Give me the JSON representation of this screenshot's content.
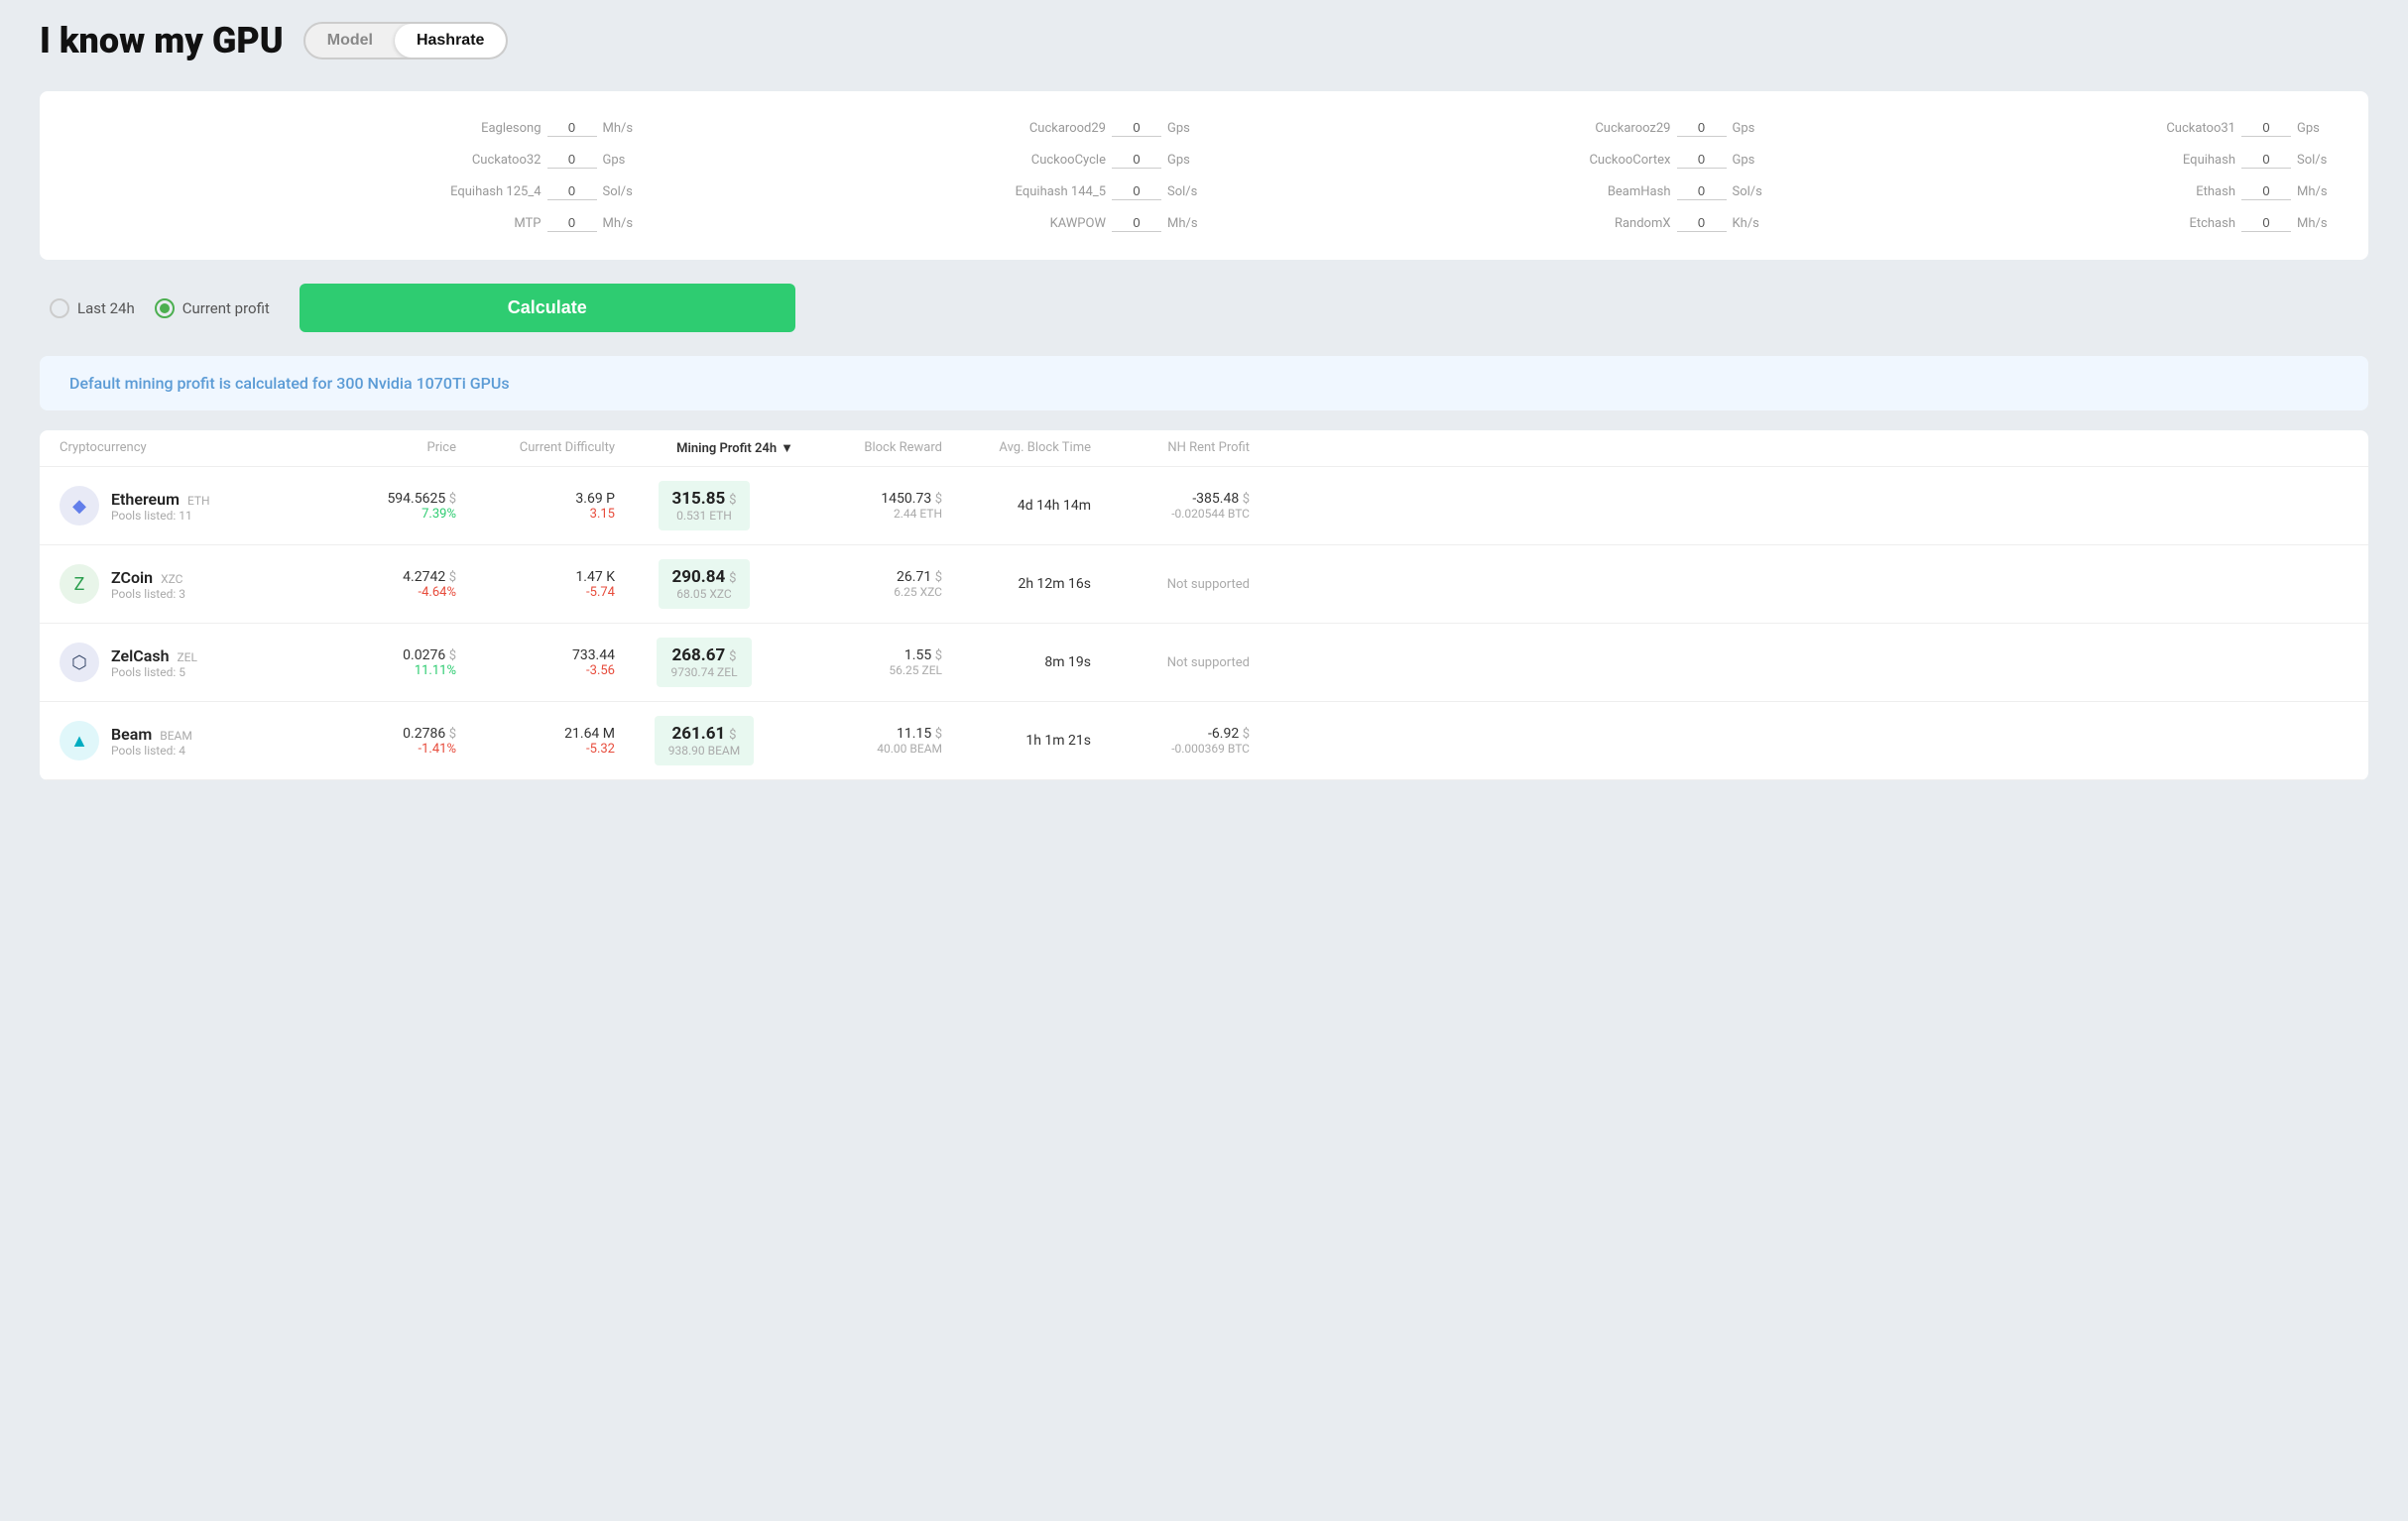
{
  "header": {
    "title": "I know my GPU",
    "toggle": {
      "model_label": "Model",
      "hashrate_label": "Hashrate",
      "active": "hashrate"
    }
  },
  "hashrate_fields": [
    {
      "label": "Eaglesong",
      "value": "0",
      "unit": "Mh/s"
    },
    {
      "label": "Cuckarood29",
      "value": "0",
      "unit": "Gps"
    },
    {
      "label": "Cuckarooz29",
      "value": "0",
      "unit": "Gps"
    },
    {
      "label": "Cuckatoo31",
      "value": "0",
      "unit": "Gps"
    },
    {
      "label": "Cuckatoo32",
      "value": "0",
      "unit": "Gps"
    },
    {
      "label": "CuckooCycle",
      "value": "0",
      "unit": "Gps"
    },
    {
      "label": "CuckooCortex",
      "value": "0",
      "unit": "Gps"
    },
    {
      "label": "Equihash",
      "value": "0",
      "unit": "Sol/s"
    },
    {
      "label": "Equihash 125_4",
      "value": "0",
      "unit": "Sol/s"
    },
    {
      "label": "Equihash 144_5",
      "value": "0",
      "unit": "Sol/s"
    },
    {
      "label": "BeamHash",
      "value": "0",
      "unit": "Sol/s"
    },
    {
      "label": "Ethash",
      "value": "0",
      "unit": "Mh/s"
    },
    {
      "label": "MTP",
      "value": "0",
      "unit": "Mh/s"
    },
    {
      "label": "KAWPOW",
      "value": "0",
      "unit": "Mh/s"
    },
    {
      "label": "RandomX",
      "value": "0",
      "unit": "Kh/s"
    },
    {
      "label": "Etchash",
      "value": "0",
      "unit": "Mh/s"
    }
  ],
  "controls": {
    "last24h_label": "Last 24h",
    "current_profit_label": "Current profit",
    "selected": "current_profit",
    "calculate_label": "Calculate"
  },
  "info_banner": {
    "text": "Default mining profit is calculated for 300 Nvidia 1070Ti GPUs"
  },
  "table": {
    "headers": [
      {
        "label": "Cryptocurrency",
        "sorted": false
      },
      {
        "label": "Price",
        "sorted": false
      },
      {
        "label": "Current Difficulty",
        "sorted": false
      },
      {
        "label": "Mining Profit 24h",
        "sorted": true
      },
      {
        "label": "Block Reward",
        "sorted": false
      },
      {
        "label": "Avg. Block Time",
        "sorted": false
      },
      {
        "label": "NH Rent Profit",
        "sorted": false
      }
    ],
    "rows": [
      {
        "coin": "Ethereum",
        "ticker": "ETH",
        "pools": "11",
        "icon_color": "#627eea",
        "icon_text": "◆",
        "price": "594.5625",
        "price_change": "7.39%",
        "price_change_positive": true,
        "difficulty": "3.69 P",
        "difficulty_change": "3.15",
        "difficulty_change_positive": false,
        "profit_main": "315.85",
        "profit_sub": "0.531 ETH",
        "block_reward": "1450.73",
        "block_reward_sub": "2.44 ETH",
        "avg_block_time": "4d 14h 14m",
        "nh_profit": "-385.48",
        "nh_profit_sub": "-0.020544 BTC",
        "nh_supported": true
      },
      {
        "coin": "ZCoin",
        "ticker": "XZC",
        "pools": "3",
        "icon_color": "#2d9f4f",
        "icon_text": "Z",
        "price": "4.2742",
        "price_change": "-4.64%",
        "price_change_positive": false,
        "difficulty": "1.47 K",
        "difficulty_change": "-5.74",
        "difficulty_change_positive": false,
        "profit_main": "290.84",
        "profit_sub": "68.05 XZC",
        "block_reward": "26.71",
        "block_reward_sub": "6.25 XZC",
        "avg_block_time": "2h 12m 16s",
        "nh_profit": "",
        "nh_profit_sub": "",
        "nh_supported": false
      },
      {
        "coin": "ZelCash",
        "ticker": "ZEL",
        "pools": "5",
        "icon_color": "#3a4a6b",
        "icon_text": "⬡",
        "price": "0.0276",
        "price_change": "11.11%",
        "price_change_positive": true,
        "difficulty": "733.44",
        "difficulty_change": "-3.56",
        "difficulty_change_positive": false,
        "profit_main": "268.67",
        "profit_sub": "9730.74 ZEL",
        "block_reward": "1.55",
        "block_reward_sub": "56.25 ZEL",
        "avg_block_time": "8m 19s",
        "nh_profit": "",
        "nh_profit_sub": "",
        "nh_supported": false
      },
      {
        "coin": "Beam",
        "ticker": "BEAM",
        "pools": "4",
        "icon_color": "#00d2ff",
        "icon_text": "▲",
        "price": "0.2786",
        "price_change": "-1.41%",
        "price_change_positive": false,
        "difficulty": "21.64 M",
        "difficulty_change": "-5.32",
        "difficulty_change_positive": false,
        "profit_main": "261.61",
        "profit_sub": "938.90 BEAM",
        "block_reward": "11.15",
        "block_reward_sub": "40.00 BEAM",
        "avg_block_time": "1h 1m 21s",
        "nh_profit": "-6.92",
        "nh_profit_sub": "-0.000369 BTC",
        "nh_supported": true
      }
    ]
  }
}
